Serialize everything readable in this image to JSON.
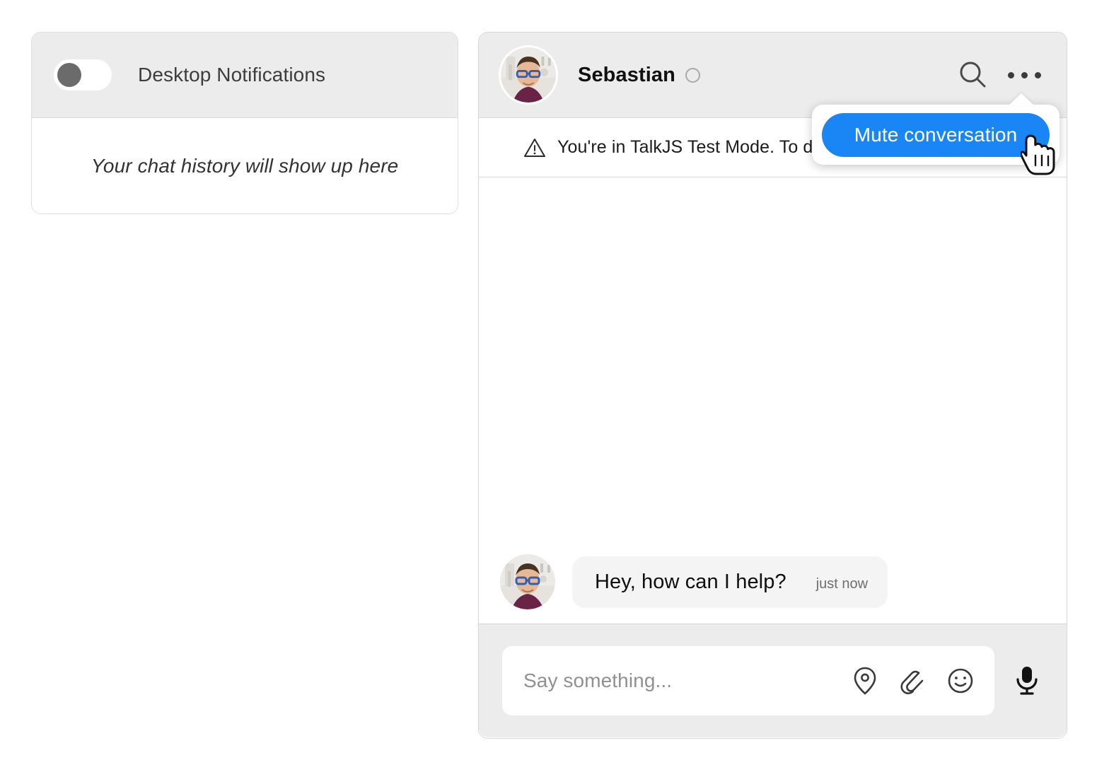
{
  "left_panel": {
    "notifications_toggle": {
      "label": "Desktop Notifications",
      "state": "off"
    },
    "empty_history_text": "Your chat history will show up here"
  },
  "chat_panel": {
    "header": {
      "name": "Sebastian",
      "presence": "offline",
      "search_icon": "search-icon",
      "more_icon": "ellipsis-icon"
    },
    "banner": {
      "icon": "warning-triangle-icon",
      "text": "You're in TalkJS Test Mode. To d"
    },
    "messages": [
      {
        "author": "Sebastian",
        "text": "Hey, how can I help?",
        "time": "just now"
      }
    ],
    "composer": {
      "placeholder": "Say something...",
      "icons": [
        "location-pin-icon",
        "paperclip-icon",
        "smiley-icon"
      ],
      "mic_icon": "microphone-icon"
    }
  },
  "popup": {
    "button_label": "Mute conversation",
    "accent_color": "#1a86f5"
  },
  "colors": {
    "accent": "#1a86f5",
    "header_bg": "#ececec",
    "panel_bg": "#ffffff",
    "bubble_bg": "#f4f4f4",
    "toggle_knob": "#6b6b6b"
  }
}
